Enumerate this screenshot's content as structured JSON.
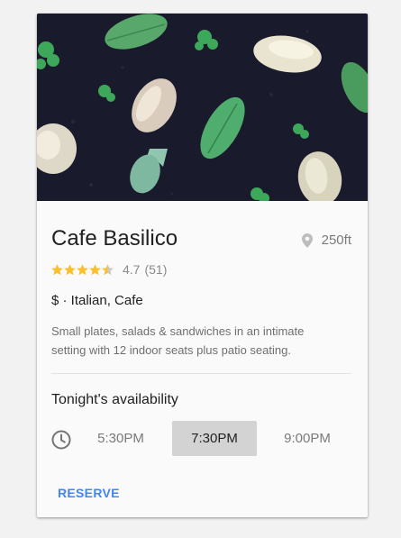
{
  "card": {
    "title": "Cafe Basilico",
    "distance": "250ft",
    "rating": {
      "value_text": "4.7",
      "count_text": "(51)",
      "stars": 4.5
    },
    "price_category": "$ · Italian, Cafe",
    "description": "Small plates, salads & sandwiches in an intimate setting with 12 indoor seats plus patio seating.",
    "availability_label": "Tonight's availability",
    "time_slots": [
      {
        "label": "5:30PM"
      },
      {
        "label": "7:30PM",
        "selected": true
      },
      {
        "label": "9:00PM"
      }
    ],
    "reserve_label": "RESERVE"
  },
  "icons": {
    "distance": "location-pin-icon",
    "time": "clock-icon",
    "rating": "star-icon"
  },
  "colors": {
    "accent": "#4285f4",
    "star": "#fbc02d",
    "selected_slot": "#d3d3d3",
    "hero_background": "#1a1a2c"
  }
}
